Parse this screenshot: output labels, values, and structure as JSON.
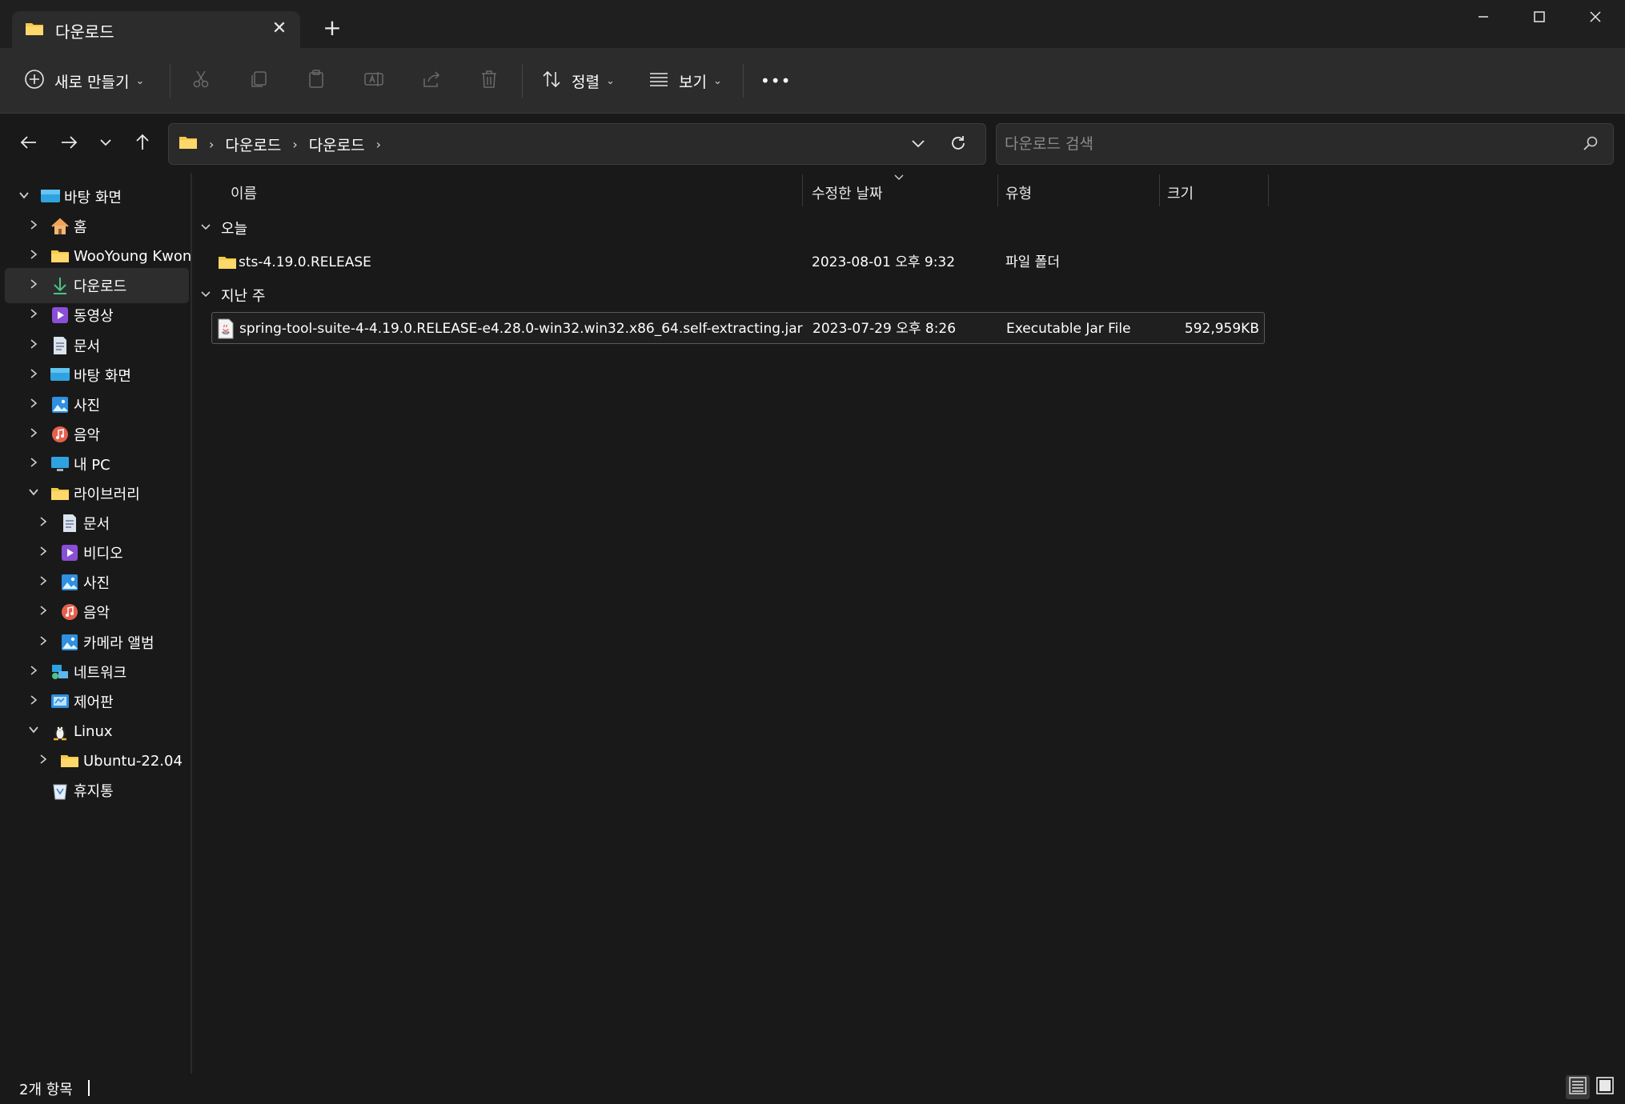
{
  "window": {
    "tab_title": "다운로드",
    "close_tab_glyph": "✕",
    "new_tab_glyph": "+",
    "minimize_glyph": "—",
    "maximize_glyph": "☐",
    "close_glyph": "✕"
  },
  "toolbar": {
    "new_label": "새로 만들기",
    "sort_label": "정렬",
    "view_label": "보기",
    "more_glyph": "•••",
    "chevron_glyph": "⌄"
  },
  "address": {
    "crumbs": [
      "다운로드",
      "다운로드"
    ],
    "separator": "›",
    "search_placeholder": "다운로드 검색"
  },
  "sidebar": {
    "items": [
      {
        "label": "바탕 화면",
        "icon": "desktop-icon",
        "expanded": true
      },
      {
        "label": "홈",
        "icon": "home-icon"
      },
      {
        "label": "WooYoung Kwon",
        "icon": "folder-icon"
      },
      {
        "label": "다운로드",
        "icon": "download-icon",
        "selected": true
      },
      {
        "label": "동영상",
        "icon": "video-icon"
      },
      {
        "label": "문서",
        "icon": "document-icon"
      },
      {
        "label": "바탕 화면",
        "icon": "desktop-icon"
      },
      {
        "label": "사진",
        "icon": "pictures-icon"
      },
      {
        "label": "음악",
        "icon": "music-icon"
      },
      {
        "label": "내 PC",
        "icon": "pc-icon"
      },
      {
        "label": "라이브러리",
        "icon": "folder-icon",
        "expanded": true
      },
      {
        "label": "문서",
        "icon": "document-icon"
      },
      {
        "label": "비디오",
        "icon": "video-icon"
      },
      {
        "label": "사진",
        "icon": "pictures-icon"
      },
      {
        "label": "음악",
        "icon": "music-icon"
      },
      {
        "label": "카메라 앨범",
        "icon": "pictures-icon"
      },
      {
        "label": "네트워크",
        "icon": "network-icon"
      },
      {
        "label": "제어판",
        "icon": "control-panel-icon"
      },
      {
        "label": "Linux",
        "icon": "linux-icon",
        "expanded": true
      },
      {
        "label": "Ubuntu-22.04",
        "icon": "folder-icon"
      },
      {
        "label": "휴지통",
        "icon": "recycle-bin-icon"
      }
    ]
  },
  "columns": {
    "name": "이름",
    "modified": "수정한 날짜",
    "type": "유형",
    "size": "크기"
  },
  "groups": [
    {
      "label": "오늘",
      "files": [
        {
          "name": "sts-4.19.0.RELEASE",
          "modified": "2023-08-01 오후 9:32",
          "type": "파일 폴더",
          "size": "",
          "icon": "folder-icon"
        }
      ]
    },
    {
      "label": "지난 주",
      "files": [
        {
          "name": "spring-tool-suite-4-4.19.0.RELEASE-e4.28.0-win32.win32.x86_64.self-extracting.jar",
          "modified": "2023-07-29 오후 8:26",
          "type": "Executable Jar File",
          "size": "592,959KB",
          "icon": "jar-file-icon"
        }
      ]
    }
  ],
  "status": {
    "item_count": "2개 항목"
  },
  "colors": {
    "accent": "#60cdff",
    "folder": "#f7c948",
    "background": "#191919",
    "toolbar": "#2c2c2c"
  }
}
